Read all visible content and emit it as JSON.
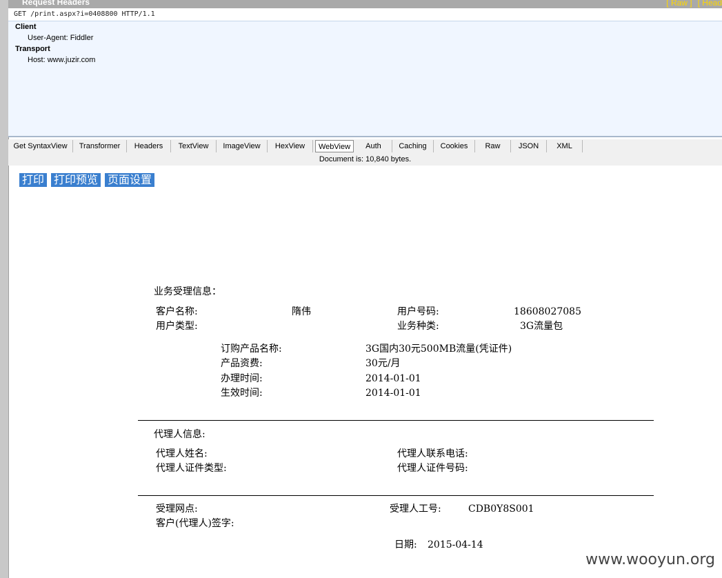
{
  "headers_panel": {
    "title": "Request Headers",
    "links": [
      "[ Raw ]",
      "[ Head"
    ],
    "request_line": "GET /print.aspx?i=0408800 HTTP/1.1",
    "groups": [
      {
        "name": "Client",
        "entries": [
          "User-Agent: Fiddler"
        ]
      },
      {
        "name": "Transport",
        "entries": [
          "Host: www.juzir.com"
        ]
      }
    ]
  },
  "tabs": [
    "Get SyntaxView",
    "Transformer",
    "Headers",
    "TextView",
    "ImageView",
    "HexView",
    "WebView",
    "Auth",
    "Caching",
    "Cookies",
    "Raw",
    "JSON",
    "XML"
  ],
  "active_tab": "WebView",
  "doc_status": "Document is: 10,840 bytes.",
  "page": {
    "buttons": [
      "打印",
      "打印预览",
      "页面设置"
    ],
    "business_section_title": "业务受理信息：",
    "customer_name_label": "客户名称:",
    "customer_name": "隋伟",
    "user_number_label": "用户号码:",
    "user_number": "18608027085",
    "user_type_label": "用户类型:",
    "business_type_label": "业务种类:",
    "business_type": "3G流量包",
    "product_name_label": "订购产品名称:",
    "product_name": "3G国内30元500MB流量(凭证件)",
    "product_fee_label": "产品资费:",
    "product_fee": "30元/月",
    "handle_time_label": "办理时间:",
    "handle_time": "2014-01-01",
    "effective_time_label": "生效时间:",
    "effective_time": "2014-01-01",
    "agent_section_title": "代理人信息:",
    "agent_name_label": "代理人姓名:",
    "agent_phone_label": "代理人联系电话:",
    "agent_id_type_label": "代理人证件类型:",
    "agent_id_number_label": "代理人证件号码:",
    "outlet_label": "受理网点:",
    "staff_id_label": "受理人工号:",
    "staff_id": "CDB0Y8S001",
    "signature_label": "客户(代理人)签字:",
    "date_label": "日期:",
    "date": "2015-04-14"
  },
  "watermark": "www.wooyun.org"
}
